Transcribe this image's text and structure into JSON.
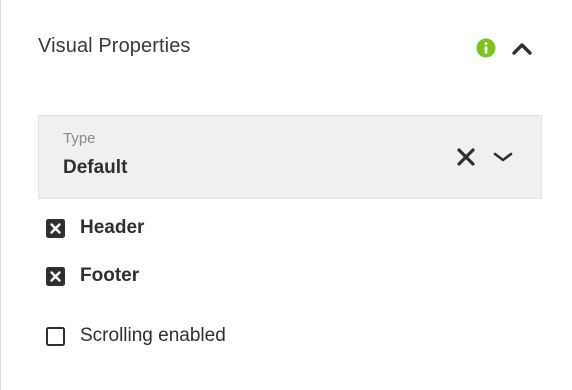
{
  "panel": {
    "title": "Visual Properties",
    "info_icon": "info-icon",
    "collapse_icon": "chevron-up-icon"
  },
  "type_select": {
    "label": "Type",
    "value": "Default",
    "clear_icon": "close-icon",
    "dropdown_icon": "chevron-down-icon"
  },
  "options": [
    {
      "label": "Header",
      "checked": true
    },
    {
      "label": "Footer",
      "checked": true
    },
    {
      "label": "Scrolling enabled",
      "checked": false
    }
  ],
  "colors": {
    "info": "#7bc41c",
    "text": "#2f2f2f",
    "select_bg": "#f0f0f0"
  }
}
